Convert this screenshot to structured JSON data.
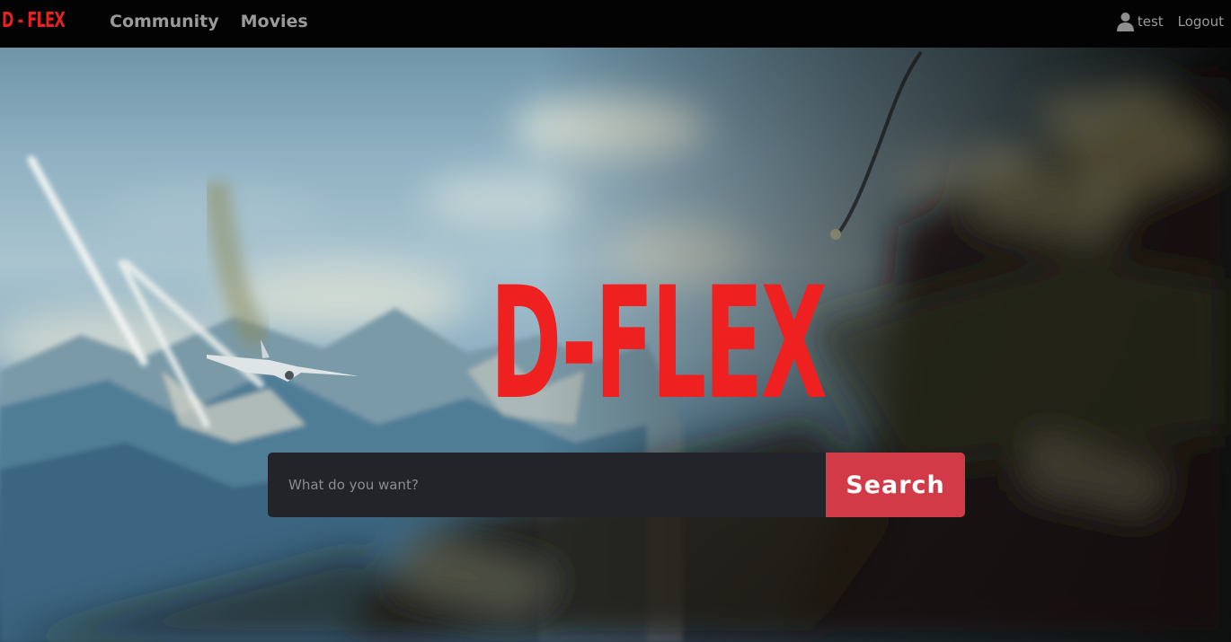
{
  "navbar": {
    "brand": "D - FLEX",
    "links": [
      {
        "label": "Community"
      },
      {
        "label": "Movies"
      }
    ],
    "user": {
      "icon": "user-icon",
      "name": "test"
    },
    "logout_label": "Logout"
  },
  "hero": {
    "title": "D-FLEX",
    "search": {
      "placeholder": "What do you want?",
      "value": "",
      "button_label": "Search"
    }
  },
  "colors": {
    "brand_red": "#e42222",
    "title_red": "#ef2020",
    "search_button": "#d33a48",
    "search_input_bg": "#222429",
    "navbar_bg": "#030303",
    "nav_text": "#9a9a9a"
  }
}
